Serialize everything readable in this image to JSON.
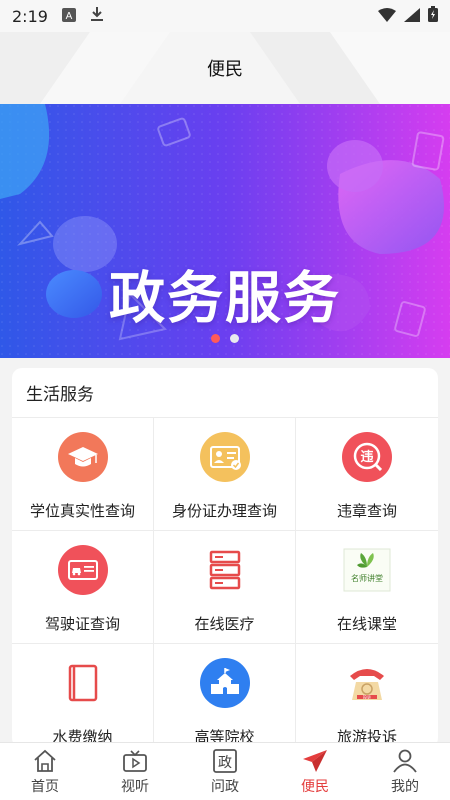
{
  "status_bar": {
    "time": "2:19"
  },
  "header": {
    "title": "便民"
  },
  "banner": {
    "title": "政务服务",
    "slide_count": 2,
    "active_slide": 1
  },
  "services": {
    "section_title": "生活服务",
    "items": [
      {
        "label": "学位真实性查询",
        "icon": "graduation-cap-icon",
        "color": "#f2785a"
      },
      {
        "label": "身份证办理查询",
        "icon": "id-card-icon",
        "color": "#f4c15d"
      },
      {
        "label": "违章查询",
        "icon": "violation-icon",
        "color": "#f0515a"
      },
      {
        "label": "驾驶证查询",
        "icon": "driver-license-icon",
        "color": "#f0515a"
      },
      {
        "label": "在线医疗",
        "icon": "server-rack-icon",
        "color": "#e64b4b"
      },
      {
        "label": "在线课堂",
        "icon": "famous-teacher-icon",
        "color": "#5aa63a",
        "badge_text": "名师讲堂"
      },
      {
        "label": "水费缴纳",
        "icon": "water-bill-icon",
        "color": "#e64b4b"
      },
      {
        "label": "高等院校",
        "icon": "school-building-icon",
        "color": "#2f7ff0"
      },
      {
        "label": "旅游投诉",
        "icon": "telephone-icon",
        "color": "#e64b4b",
        "badge_text": "投诉"
      }
    ]
  },
  "tabbar": {
    "active_color": "#e43d3d",
    "tabs": [
      {
        "label": "首页",
        "icon": "home-icon"
      },
      {
        "label": "视听",
        "icon": "tv-play-icon"
      },
      {
        "label": "问政",
        "icon": "politics-icon",
        "icon_text": "政"
      },
      {
        "label": "便民",
        "icon": "paper-plane-icon",
        "active": true
      },
      {
        "label": "我的",
        "icon": "profile-icon"
      }
    ]
  }
}
